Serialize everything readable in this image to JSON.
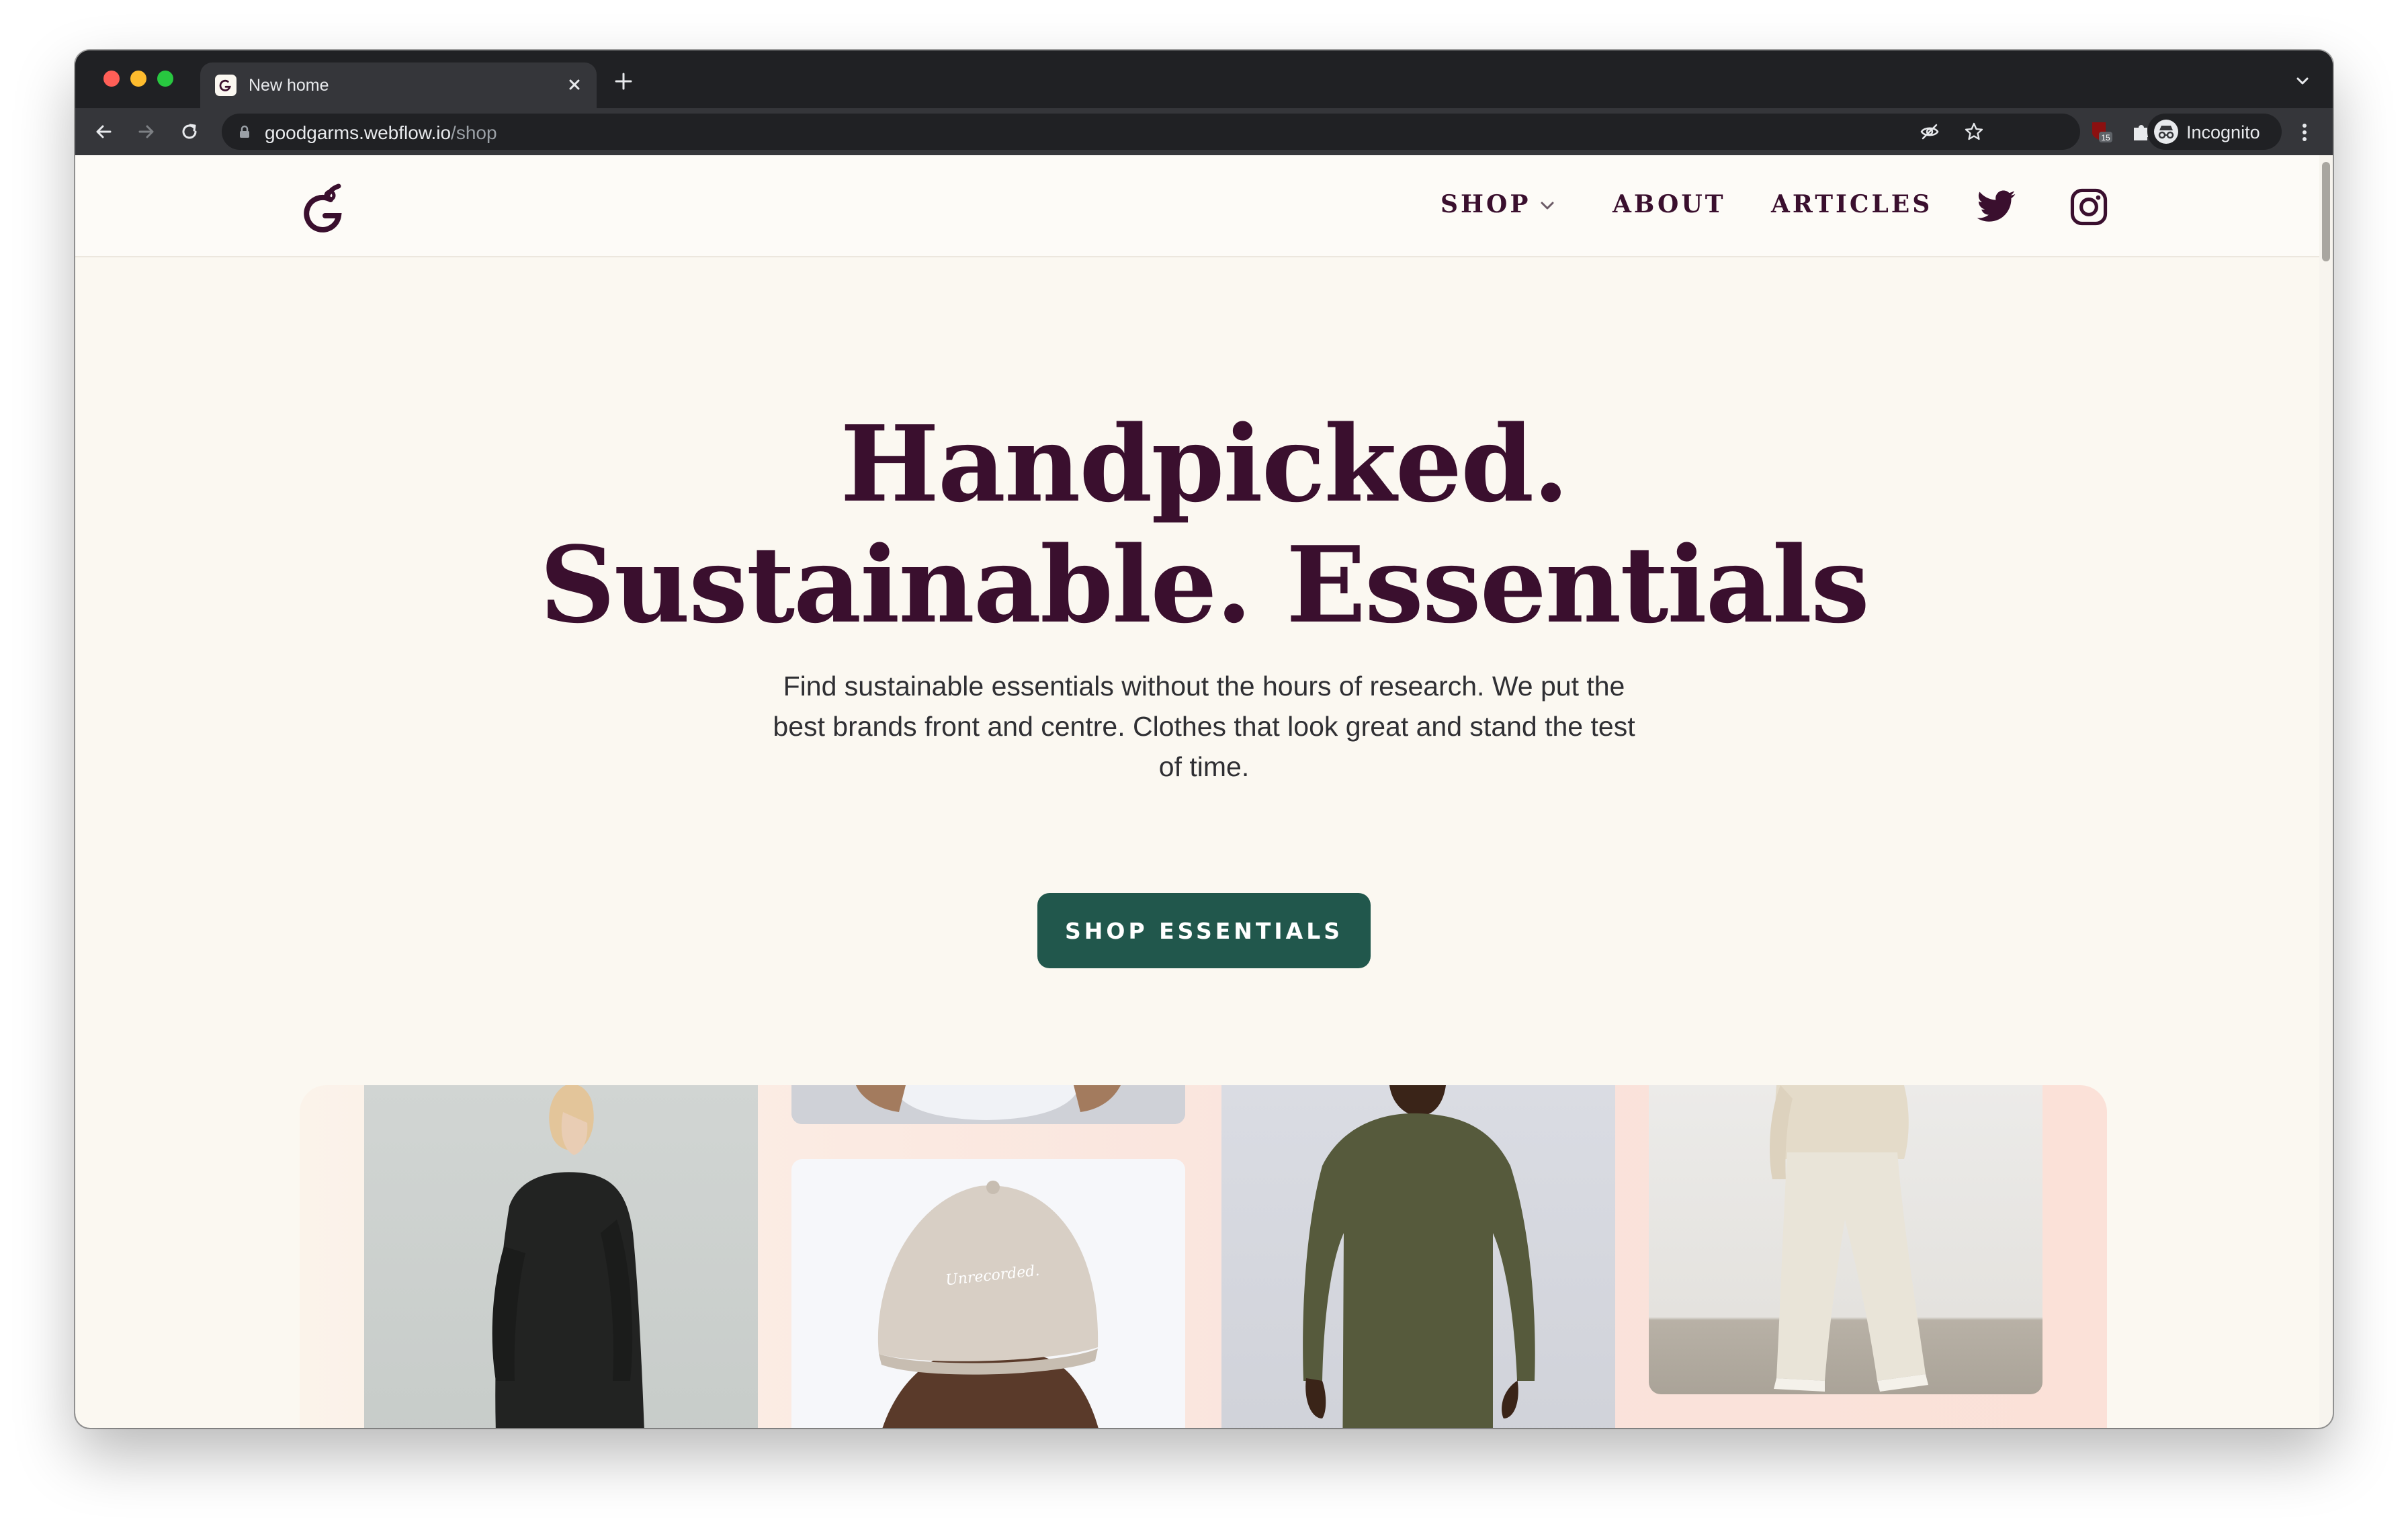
{
  "browser": {
    "tab_title": "New home",
    "url_host": "goodgarms.webflow.io",
    "url_path": "/shop",
    "profile_label": "Incognito",
    "extension_badge": "15"
  },
  "site": {
    "nav": {
      "shop": "SHOP",
      "about": "ABOUT",
      "articles": "ARTICLES"
    },
    "hero": {
      "title_line1": "Handpicked.",
      "title_line2": "Sustainable. Essentials",
      "subtitle": "Find sustainable essentials without the hours of research. We put the best brands front and centre. Clothes that look great and stand the test of time.",
      "cta_label": "SHOP ESSENTIALS"
    },
    "gallery": {
      "cap_text": "Unrecorded."
    }
  },
  "colors": {
    "brand_plum": "#3a0f2e",
    "cta_green": "#21574c",
    "page_bg": "#fbf8f1"
  },
  "icons": {
    "logo": "goodgarms-g-logo",
    "twitter": "twitter-icon",
    "instagram": "instagram-icon"
  }
}
